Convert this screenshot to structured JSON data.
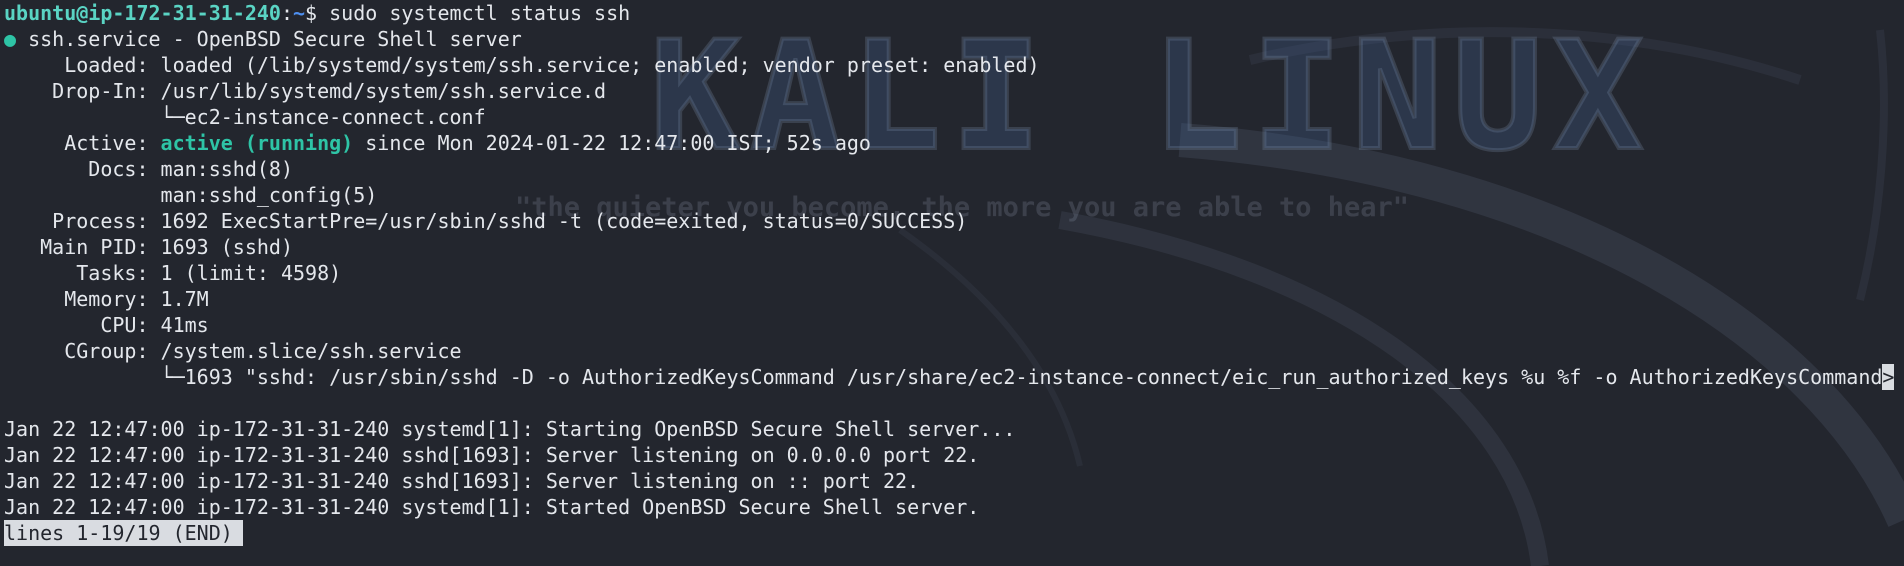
{
  "prompt": {
    "user_host": "ubuntu@ip-172-31-31-240",
    "colon": ":",
    "path": "~",
    "symbol": "$",
    "command": " sudo systemctl status ssh"
  },
  "service": {
    "dot": "●",
    "header": " ssh.service - OpenBSD Secure Shell server",
    "loaded_label": "     Loaded: ",
    "loaded_value": "loaded (/lib/systemd/system/ssh.service; enabled; vendor preset: enabled)",
    "dropin_label": "    Drop-In: ",
    "dropin_value": "/usr/lib/systemd/system/ssh.service.d",
    "dropin_child": "             └─ec2-instance-connect.conf",
    "active_label": "     Active: ",
    "active_state": "active (running)",
    "active_since": " since Mon 2024-01-22 12:47:00 IST; 52s ago",
    "docs_label": "       Docs: ",
    "docs_1": "man:sshd(8)",
    "docs_2": "             man:sshd_config(5)",
    "process_label": "    Process: ",
    "process_value": "1692 ExecStartPre=/usr/sbin/sshd -t (code=exited, status=0/SUCCESS)",
    "mainpid_label": "   Main PID: ",
    "mainpid_value": "1693 (sshd)",
    "tasks_label": "      Tasks: ",
    "tasks_value": "1 (limit: 4598)",
    "memory_label": "     Memory: ",
    "memory_value": "1.7M",
    "cpu_label": "        CPU: ",
    "cpu_value": "41ms",
    "cgroup_label": "     CGroup: ",
    "cgroup_value": "/system.slice/ssh.service",
    "cgroup_child": "             └─1693 \"sshd: /usr/sbin/sshd -D -o AuthorizedKeysCommand /usr/share/ec2-instance-connect/eic_run_authorized_keys %u %f -o AuthorizedKeysCommand",
    "truncate_marker": ">"
  },
  "log_lines": [
    "Jan 22 12:47:00 ip-172-31-31-240 systemd[1]: Starting OpenBSD Secure Shell server...",
    "Jan 22 12:47:00 ip-172-31-31-240 sshd[1693]: Server listening on 0.0.0.0 port 22.",
    "Jan 22 12:47:00 ip-172-31-31-240 sshd[1693]: Server listening on :: port 22.",
    "Jan 22 12:47:00 ip-172-31-31-240 systemd[1]: Started OpenBSD Secure Shell server."
  ],
  "pager_status": "lines 1-19/19 (END)",
  "wallpaper": {
    "title": "KALI LINUX",
    "tagline": "\"the quieter you become, the more you are able to hear\""
  },
  "colors": {
    "background": "#23262e",
    "text": "#e4e7ec",
    "prompt_user": "#5ad4c4",
    "prompt_path": "#4e8ff0",
    "active_green": "#2ec4a6"
  }
}
